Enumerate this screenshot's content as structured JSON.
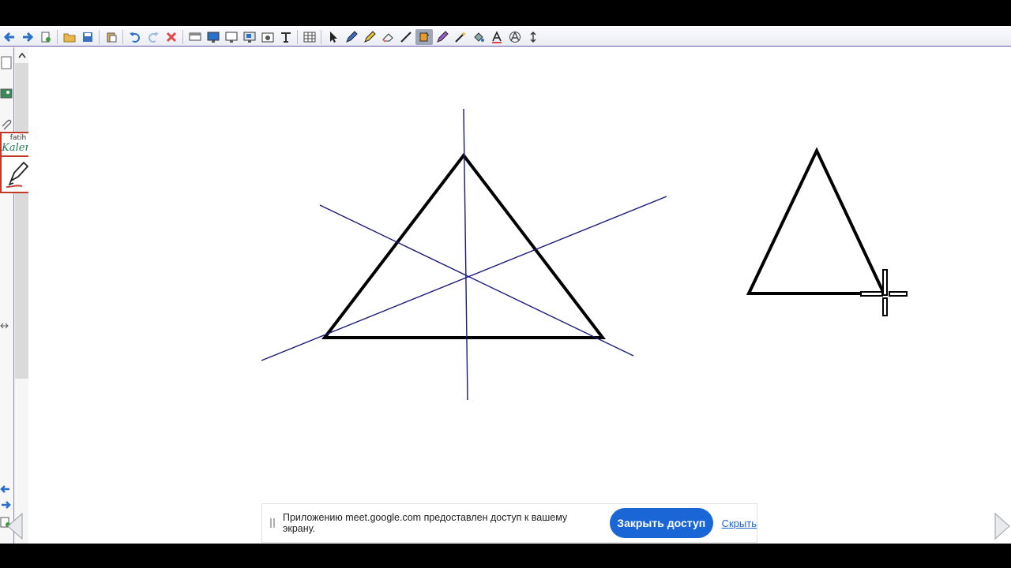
{
  "toolbar": {
    "icons": [
      "back-arrow-icon",
      "forward-arrow-icon",
      "page-add-icon",
      "open-folder-icon",
      "save-icon",
      "paste-icon",
      "undo-icon",
      "redo-icon",
      "delete-icon",
      "screen-shade-icon",
      "display-icon",
      "monitor-icon",
      "capture-icon",
      "camera-icon",
      "text-tool-icon",
      "table-icon",
      "select-arrow-icon",
      "pen-icon",
      "highlighter-icon",
      "eraser-icon",
      "line-tool-icon",
      "fill-icon",
      "creative-pen-icon",
      "magic-pen-icon",
      "paint-bucket-icon",
      "font-icon",
      "text-recognition-icon",
      "move-toolbar-icon"
    ],
    "active_tool": "fill-icon",
    "accent": "#6a5aa8"
  },
  "sidebar": {
    "brand_top": "fatih",
    "brand_bottom": "Kalem"
  },
  "banner": {
    "message": "Приложению meet.google.com предоставлен доступ к вашему экрану.",
    "stop_button": "Закрыть доступ",
    "hide_link": "Скрыть",
    "button_color": "#1a66d6"
  },
  "drawing": {
    "stroke_color": "#000000",
    "guide_color": "#1a1a7a"
  }
}
